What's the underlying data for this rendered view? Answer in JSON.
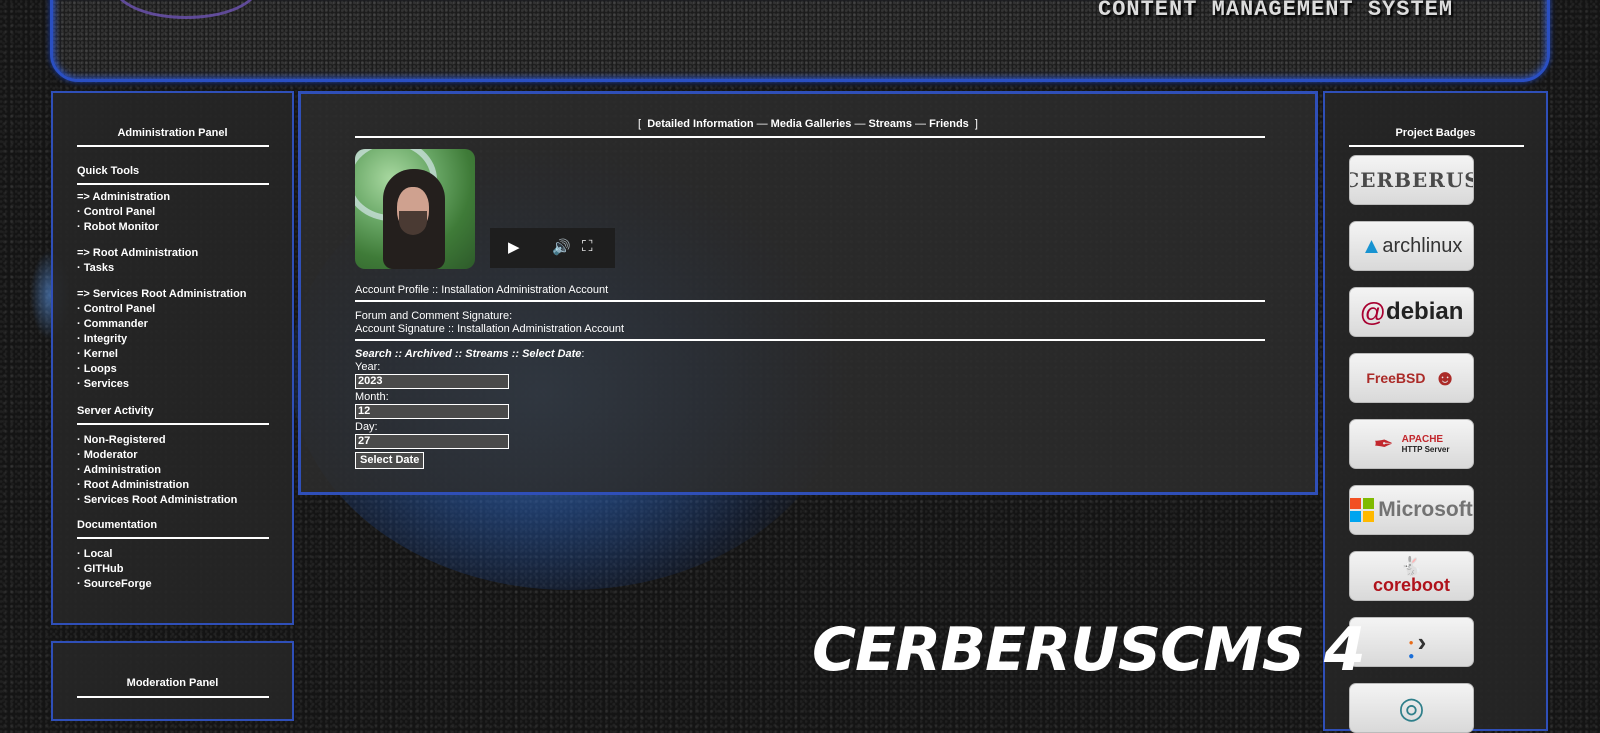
{
  "header": {
    "tagline": "CONTENT MANAGEMENT SYSTEM"
  },
  "left_panel": {
    "title": "Administration Panel",
    "quick_tools": {
      "heading": "Quick Tools",
      "groups": [
        {
          "label": "=> Administration",
          "items": [
            "Control Panel",
            "Robot Monitor"
          ]
        },
        {
          "label": "=> Root Administration",
          "items": [
            "Tasks"
          ]
        },
        {
          "label": "=> Services Root Administration",
          "items": [
            "Control Panel",
            "Commander",
            "Integrity",
            "Kernel",
            "Loops",
            "Services"
          ]
        }
      ]
    },
    "server_activity": {
      "heading": "Server Activity",
      "items": [
        "Non-Registered",
        "Moderator",
        "Administration",
        "Root Administration",
        "Services Root Administration"
      ]
    },
    "documentation": {
      "heading": "Documentation",
      "items": [
        "Local",
        "GITHub",
        "SourceForge"
      ]
    }
  },
  "moderation_panel": {
    "title": "Moderation Panel"
  },
  "main": {
    "nav": {
      "open_bracket": "[",
      "close_bracket": "]",
      "separator": "—",
      "links": [
        "Detailed Information",
        "Media Galleries",
        "Streams",
        "Friends"
      ]
    },
    "player": {
      "play_icon": "play-icon",
      "volume_icon": "volume-icon",
      "fullscreen_icon": "fullscreen-icon"
    },
    "profile_line": "Account Profile :: Installation Administration Account",
    "signature_label": "Forum and Comment Signature:",
    "signature_text": "Account Signature :: Installation Administration Account",
    "search": {
      "heading": "Search :: Archived :: Streams :: Select Date",
      "colon": ":",
      "year_label": "Year:",
      "year_value": "2023",
      "month_label": "Month:",
      "month_value": "12",
      "day_label": "Day:",
      "day_value": "27",
      "submit_label": "Select Date"
    }
  },
  "right_panel": {
    "title": "Project Badges",
    "badges": [
      {
        "name": "cerberus",
        "text": "CERBERUS",
        "color": "#555555"
      },
      {
        "name": "archlinux",
        "text": "archlinux",
        "color": "#1793d1"
      },
      {
        "name": "debian",
        "text": "debian",
        "color": "#a80030"
      },
      {
        "name": "freebsd",
        "text": "FreeBSD",
        "color": "#ab2b28"
      },
      {
        "name": "apache",
        "text": "APACHE",
        "subtext": "HTTP Server",
        "color": "#c2272d"
      },
      {
        "name": "microsoft",
        "text": "Microsoft",
        "color": "#737373"
      },
      {
        "name": "coreboot",
        "text": "coreboot",
        "color": "#b0121b"
      },
      {
        "name": "arrow-logo",
        "text": "",
        "color": "#333333"
      },
      {
        "name": "cloud-logo",
        "text": "",
        "color": "#2f7f8a"
      }
    ]
  },
  "brand": {
    "text": "CERBERUSCMS 4"
  }
}
